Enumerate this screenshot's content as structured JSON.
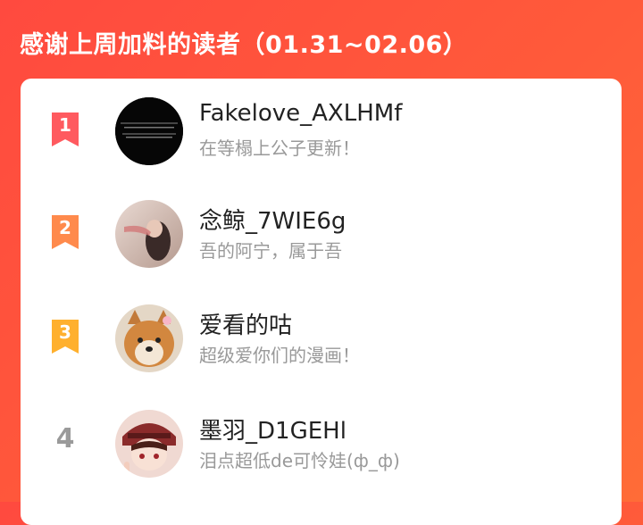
{
  "title": "感谢上周加料的读者（01.31~02.06）",
  "colors": {
    "rank1": "#ff5a5f",
    "rank2": "#ff8a4c",
    "rank3": "#ffb02e",
    "rank_plain": "#9a9a9a"
  },
  "readers": [
    {
      "rank": "1",
      "name": "Fakelove_AXLHMf",
      "desc": "在等榻上公子更新！",
      "avatar_icon": "dark-text-avatar"
    },
    {
      "rank": "2",
      "name": "念鲸_7WIE6g",
      "desc": "吾的阿宁，属于吾",
      "avatar_icon": "girl-photo-avatar"
    },
    {
      "rank": "3",
      "name": "爱看的咕",
      "desc": "超级爱你们的漫画！",
      "avatar_icon": "shiba-dog-avatar"
    },
    {
      "rank": "4",
      "name": "墨羽_D1GEHl",
      "desc": "泪点超低de可怜娃(ф_ф)",
      "avatar_icon": "anime-boy-avatar"
    }
  ]
}
